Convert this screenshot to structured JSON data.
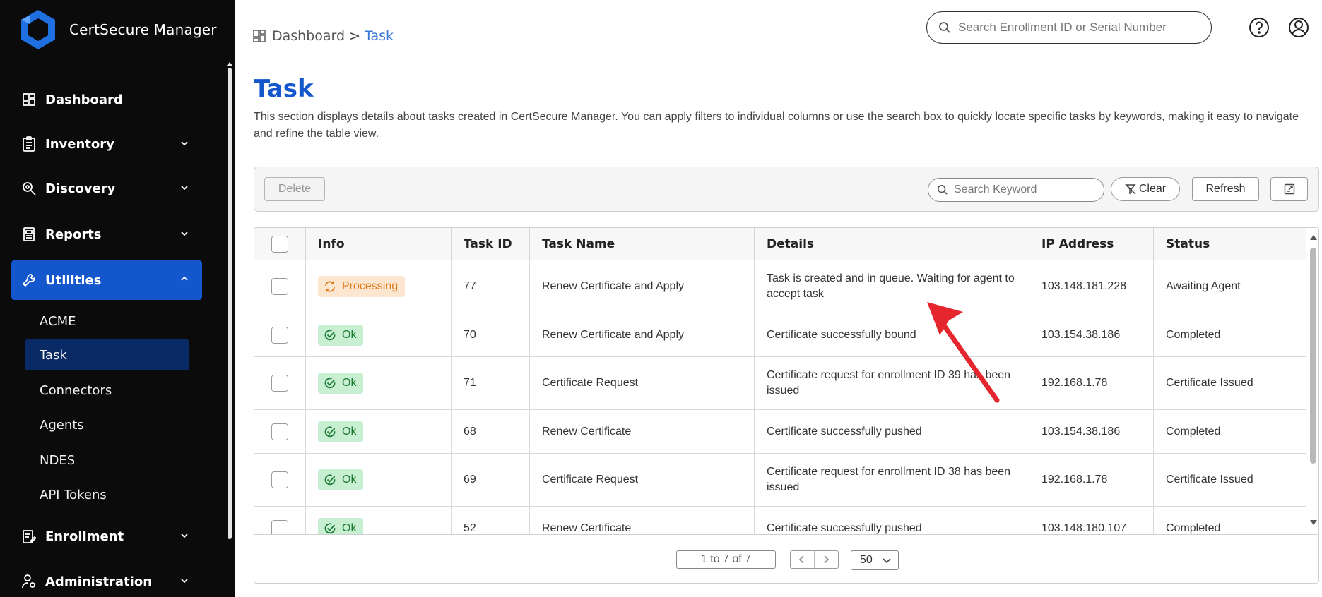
{
  "app": {
    "title": "CertSecure Manager"
  },
  "sidebar": {
    "items": [
      {
        "label": "Dashboard"
      },
      {
        "label": "Inventory"
      },
      {
        "label": "Discovery"
      },
      {
        "label": "Reports"
      },
      {
        "label": "Utilities",
        "expanded": true,
        "active": true
      },
      {
        "label": "Enrollment"
      },
      {
        "label": "Administration"
      }
    ],
    "utilities_sub": [
      {
        "label": "ACME"
      },
      {
        "label": "Task",
        "active": true
      },
      {
        "label": "Connectors"
      },
      {
        "label": "Agents"
      },
      {
        "label": "NDES"
      },
      {
        "label": "API Tokens"
      }
    ]
  },
  "header": {
    "breadcrumb_root": "Dashboard",
    "breadcrumb_sep": ">",
    "breadcrumb_current": "Task",
    "search_placeholder": "Search Enrollment ID or Serial Number"
  },
  "page": {
    "title": "Task",
    "description": "This section displays details about tasks created in CertSecure Manager. You can apply filters to individual columns or use the search box to quickly locate specific tasks by keywords, making it easy to navigate and refine the table view."
  },
  "toolbar": {
    "delete_label": "Delete",
    "search_placeholder": "Search Keyword",
    "clear_label": "Clear",
    "refresh_label": "Refresh"
  },
  "table": {
    "columns": [
      "Info",
      "Task ID",
      "Task Name",
      "Details",
      "IP Address",
      "Status"
    ],
    "rows": [
      {
        "info": "Processing",
        "task_id": "77",
        "task_name": "Renew Certificate and Apply",
        "details": "Task is created and in queue. Waiting for agent to accept task",
        "ip": "103.148.181.228",
        "status": "Awaiting Agent"
      },
      {
        "info": "Ok",
        "task_id": "70",
        "task_name": "Renew Certificate and Apply",
        "details": "Certificate successfully bound",
        "ip": "103.154.38.186",
        "status": "Completed"
      },
      {
        "info": "Ok",
        "task_id": "71",
        "task_name": "Certificate Request",
        "details": "Certificate request for enrollment ID 39 has been issued",
        "ip": "192.168.1.78",
        "status": "Certificate Issued"
      },
      {
        "info": "Ok",
        "task_id": "68",
        "task_name": "Renew Certificate",
        "details": "Certificate successfully pushed",
        "ip": "103.154.38.186",
        "status": "Completed"
      },
      {
        "info": "Ok",
        "task_id": "69",
        "task_name": "Certificate Request",
        "details": "Certificate request for enrollment ID 38 has been issued",
        "ip": "192.168.1.78",
        "status": "Certificate Issued"
      },
      {
        "info": "Ok",
        "task_id": "52",
        "task_name": "Renew Certificate",
        "details": "Certificate successfully pushed",
        "ip": "103.148.180.107",
        "status": "Completed"
      }
    ]
  },
  "pagination": {
    "summary": "1 to 7 of 7",
    "page_size": "50"
  },
  "colors": {
    "brand": "#1457cc",
    "sidebar_bg": "#0b0b0c",
    "ok_bg": "#c9efd2",
    "processing_bg": "#fde6cf",
    "annotation_arrow": "#e5262f"
  }
}
